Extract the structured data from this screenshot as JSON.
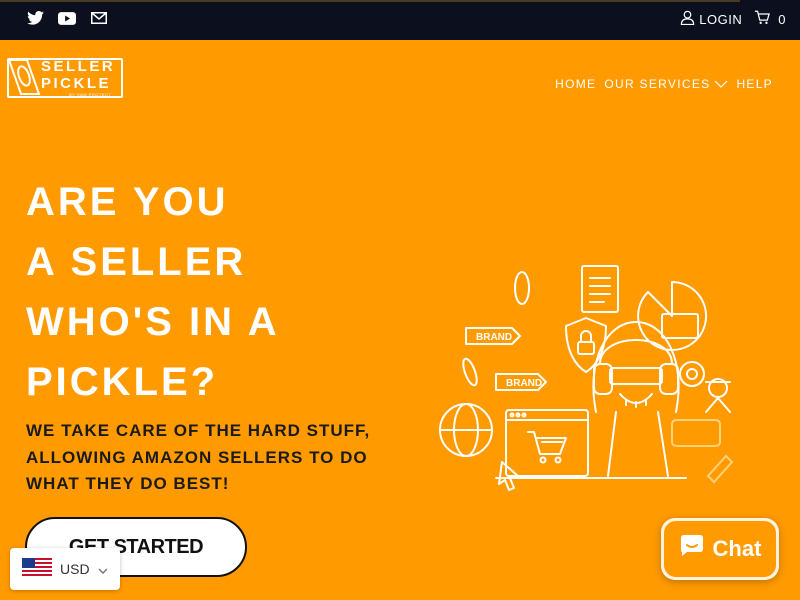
{
  "topbar": {
    "social_icons": [
      "twitter-icon",
      "youtube-icon",
      "mail-icon"
    ],
    "login_label": "LOGIN",
    "cart_count": "0"
  },
  "logo": {
    "line1": "SELLER",
    "line2": "PICKLE",
    "tagline": "BY SAM PROTECT"
  },
  "nav": {
    "items": [
      {
        "label": "HOME"
      },
      {
        "label": "OUR SERVICES"
      },
      {
        "label": "HELP"
      }
    ]
  },
  "hero": {
    "title_lines": [
      "ARE YOU",
      "A SELLER",
      "WHO'S IN A",
      "PICKLE?"
    ],
    "subtitle_lines": [
      "WE TAKE CARE OF THE HARD STUFF,",
      "ALLOWING AMAZON SELLERS TO DO",
      "WHAT THEY DO BEST!"
    ],
    "cta_label": "GET STARTED",
    "illustration_labels": [
      "BRAND",
      "BRAND"
    ]
  },
  "currency": {
    "selected": "USD"
  },
  "chat": {
    "label": "Chat"
  },
  "colors": {
    "background": "#ff9a00",
    "topbar": "#0b0f1e",
    "text_dark": "#1a1a1a",
    "white": "#ffffff"
  }
}
